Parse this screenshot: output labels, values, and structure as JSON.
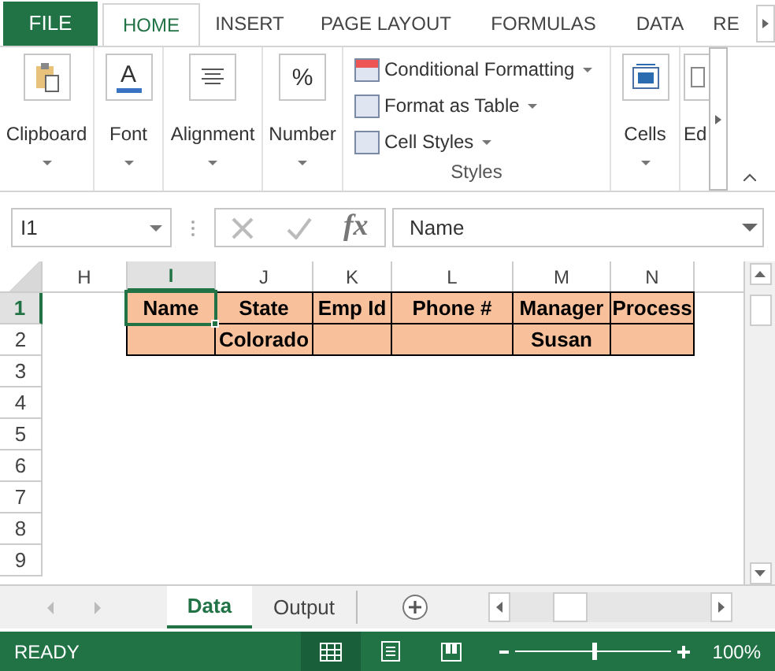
{
  "ribbon_tabs": [
    {
      "label": "FILE",
      "kind": "file",
      "selected": false
    },
    {
      "label": "HOME",
      "kind": "tab",
      "selected": true
    },
    {
      "label": "INSERT",
      "kind": "tab",
      "selected": false
    },
    {
      "label": "PAGE LAYOUT",
      "kind": "tab",
      "selected": false
    },
    {
      "label": "FORMULAS",
      "kind": "tab",
      "selected": false
    },
    {
      "label": "DATA",
      "kind": "tab",
      "selected": false
    },
    {
      "label": "RE",
      "kind": "tab",
      "selected": false
    }
  ],
  "ribbon_groups": [
    {
      "kind": "button",
      "label": "Clipboard"
    },
    {
      "kind": "button",
      "label": "Font",
      "icon_text": "A"
    },
    {
      "kind": "button",
      "label": "Alignment"
    },
    {
      "kind": "button",
      "label": "Number",
      "icon_text": "%"
    },
    {
      "kind": "styles",
      "label": "Styles",
      "commands": [
        "Conditional Formatting",
        "Format as Table",
        "Cell Styles"
      ]
    },
    {
      "kind": "button",
      "label": "Cells"
    },
    {
      "kind": "button",
      "label": "Ed"
    }
  ],
  "formula_bar": {
    "name_box": "I1",
    "fx": "fx",
    "formula": "Name"
  },
  "sheet": {
    "columns": [
      {
        "label": "H",
        "selected": false
      },
      {
        "label": "I",
        "selected": true
      },
      {
        "label": "J",
        "selected": false
      },
      {
        "label": "K",
        "selected": false
      },
      {
        "label": "L",
        "selected": false
      },
      {
        "label": "M",
        "selected": false
      },
      {
        "label": "N",
        "selected": false
      }
    ],
    "rows": [
      {
        "label": "1",
        "selected": true,
        "cells": {
          "I": "Name",
          "J": "State",
          "K": "Emp Id",
          "L": "Phone #",
          "M": "Manager",
          "N": "Process"
        }
      },
      {
        "label": "2",
        "selected": false,
        "cells": {
          "J": "Colorado",
          "M": "Susan"
        }
      },
      {
        "label": "3",
        "selected": false
      },
      {
        "label": "4",
        "selected": false
      },
      {
        "label": "5",
        "selected": false
      },
      {
        "label": "6",
        "selected": false
      },
      {
        "label": "7",
        "selected": false
      },
      {
        "label": "8",
        "selected": false
      },
      {
        "label": "9",
        "selected": false
      }
    ]
  },
  "sheet_tabs": [
    {
      "label": "Data",
      "selected": true
    },
    {
      "label": "Output",
      "selected": false
    }
  ],
  "status_bar": {
    "mode": "READY",
    "views": [
      {
        "kind": "normal",
        "selected": true
      },
      {
        "kind": "page_layout",
        "selected": false
      },
      {
        "kind": "page_break",
        "selected": false
      }
    ],
    "zoom": {
      "level": 0.5,
      "reading": "100%"
    }
  }
}
